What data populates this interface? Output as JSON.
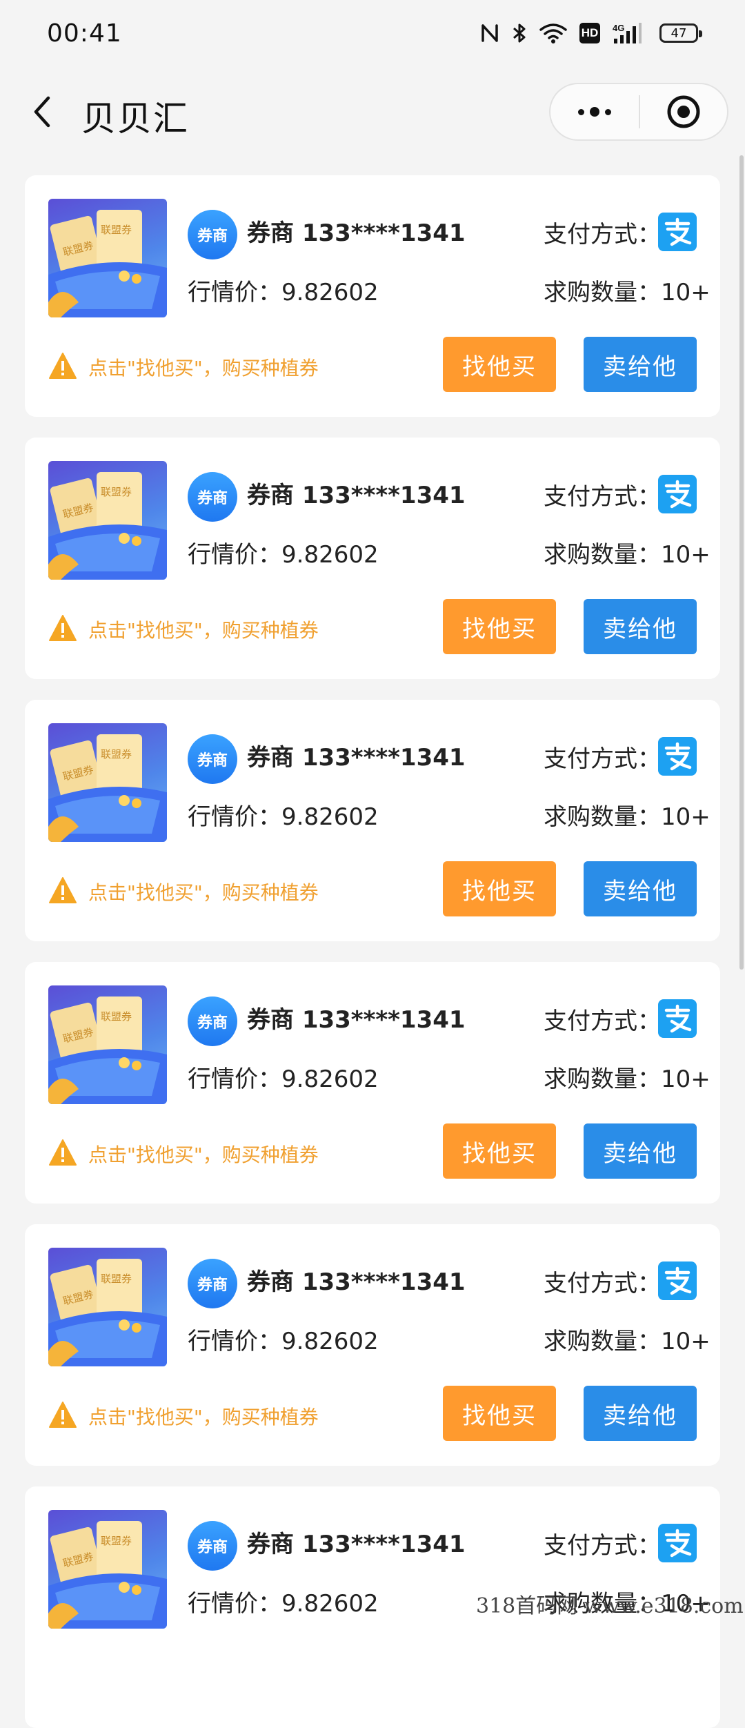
{
  "status_bar": {
    "time": "00:41",
    "battery": "47",
    "hd": "HD",
    "net": "4G"
  },
  "nav": {
    "title": "贝贝汇"
  },
  "cards": [
    {
      "badge": "券商",
      "seller": "券商 133****1341",
      "pay_label": "支付方式：",
      "price": "行情价：9.82602",
      "qty": "求购数量：10+",
      "hint": "点击\"找他买\"，购买种植券",
      "buy_label": "找他买",
      "sell_label": "卖给他",
      "thumb_tag1": "联盟券",
      "thumb_tag2": "联盟券"
    },
    {
      "badge": "券商",
      "seller": "券商 133****1341",
      "pay_label": "支付方式：",
      "price": "行情价：9.82602",
      "qty": "求购数量：10+",
      "hint": "点击\"找他买\"，购买种植券",
      "buy_label": "找他买",
      "sell_label": "卖给他",
      "thumb_tag1": "联盟券",
      "thumb_tag2": "联盟券"
    },
    {
      "badge": "券商",
      "seller": "券商 133****1341",
      "pay_label": "支付方式：",
      "price": "行情价：9.82602",
      "qty": "求购数量：10+",
      "hint": "点击\"找他买\"，购买种植券",
      "buy_label": "找他买",
      "sell_label": "卖给他",
      "thumb_tag1": "联盟券",
      "thumb_tag2": "联盟券"
    },
    {
      "badge": "券商",
      "seller": "券商 133****1341",
      "pay_label": "支付方式：",
      "price": "行情价：9.82602",
      "qty": "求购数量：10+",
      "hint": "点击\"找他买\"，购买种植券",
      "buy_label": "找他买",
      "sell_label": "卖给他",
      "thumb_tag1": "联盟券",
      "thumb_tag2": "联盟券"
    },
    {
      "badge": "券商",
      "seller": "券商 133****1341",
      "pay_label": "支付方式：",
      "price": "行情价：9.82602",
      "qty": "求购数量：10+",
      "hint": "点击\"找他买\"，购买种植券",
      "buy_label": "找他买",
      "sell_label": "卖给他",
      "thumb_tag1": "联盟券",
      "thumb_tag2": "联盟券"
    },
    {
      "badge": "券商",
      "seller": "券商 133****1341",
      "pay_label": "支付方式：",
      "price": "行情价：9.82602",
      "qty": "求购数量：10+",
      "hint": "",
      "buy_label": "",
      "sell_label": "",
      "thumb_tag1": "联盟券",
      "thumb_tag2": "联盟券"
    }
  ],
  "watermark": "318首码网 www.e318.com",
  "colors": {
    "buy": "#ff9a2e",
    "sell": "#2a8de8",
    "hint": "#f0a030",
    "alipay": "#1da1f2"
  }
}
